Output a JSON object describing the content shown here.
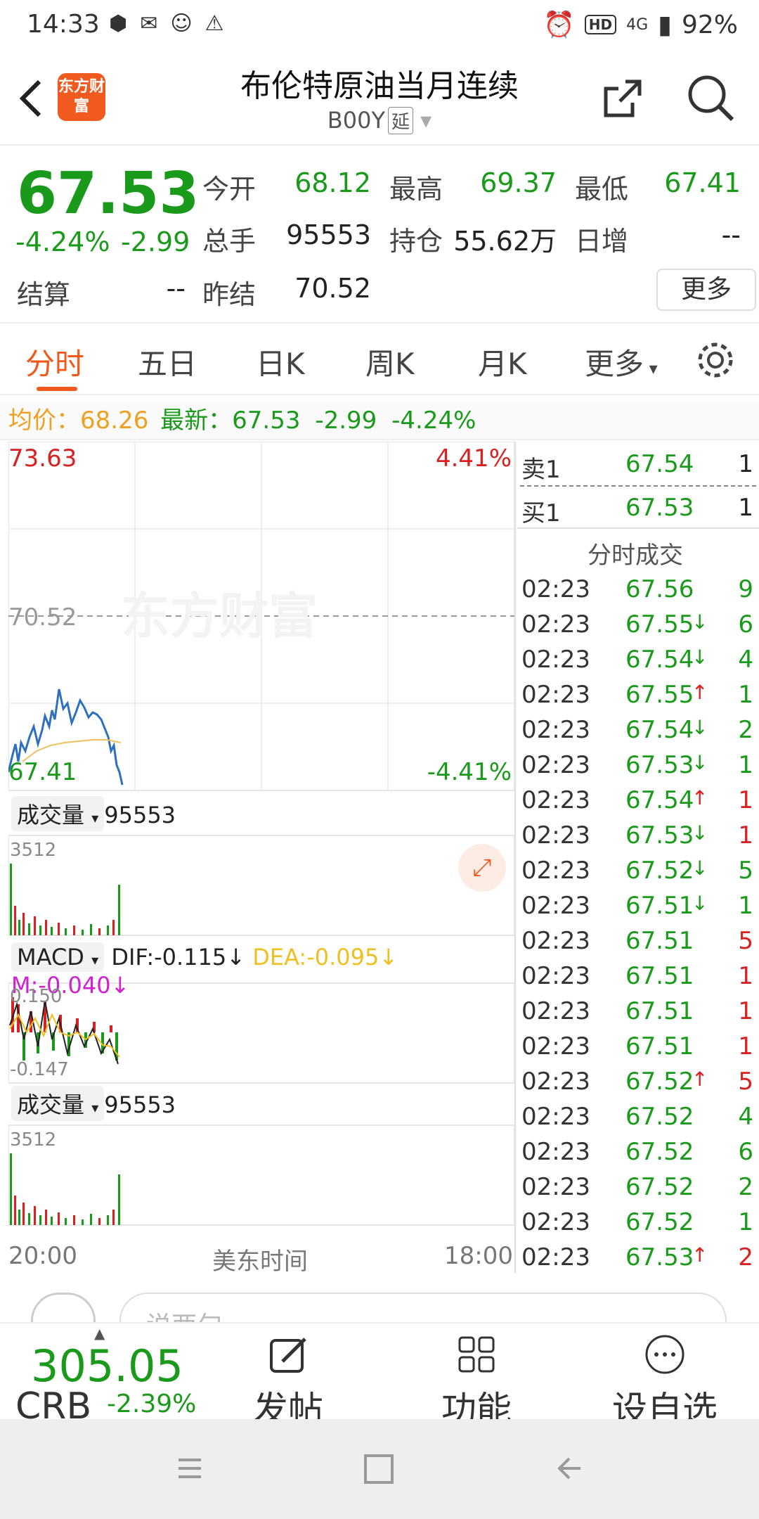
{
  "status_bar": {
    "time": "14:33",
    "battery": "92%",
    "network": "4G"
  },
  "header": {
    "title": "布伦特原油当月连续",
    "code": "B00Y",
    "delay_badge": "延",
    "logo_text": "东方财富"
  },
  "quote": {
    "price": "67.53",
    "change_pct": "-4.24%",
    "change": "-2.99",
    "open_label": "今开",
    "open": "68.12",
    "high_label": "最高",
    "high": "69.37",
    "low_label": "最低",
    "low": "67.41",
    "volume_label": "总手",
    "volume": "95553",
    "oi_label": "持仓",
    "oi": "55.62万",
    "daily_inc_label": "日增",
    "daily_inc": "--",
    "settle_label": "结算",
    "settle": "--",
    "prev_settle_label": "昨结",
    "prev_settle": "70.52",
    "more_button": "更多"
  },
  "tabs": [
    "分时",
    "五日",
    "日K",
    "周K",
    "月K",
    "更多"
  ],
  "avg_line": {
    "avg_label": "均价：",
    "avg": "68.26",
    "latest_label": "最新：",
    "latest": "67.53",
    "change": "-2.99",
    "pct": "-4.24%"
  },
  "chart": {
    "price_high": "73.63",
    "pct_high": "4.41%",
    "prev_close": "70.52",
    "price_low": "67.41",
    "pct_low": "-4.41%",
    "watermark": "东方财富",
    "vol_label": "成交量",
    "vol_value": "95553",
    "vol_max": "3512",
    "macd_label": "MACD",
    "dif": "DIF:-0.115",
    "dea": "DEA:-0.095",
    "m": "M:-0.040",
    "macd_high": "0.150",
    "macd_low": "-0.147",
    "vol2_label": "成交量",
    "vol2_value": "95553",
    "vol2_max": "3512",
    "time_start": "20:00",
    "time_mid": "美东时间",
    "time_end": "18:00"
  },
  "order_book": {
    "sell_label": "卖1",
    "sell_price": "67.54",
    "sell_vol": "1",
    "buy_label": "买1",
    "buy_price": "67.53",
    "buy_vol": "1",
    "trades_title": "分时成交"
  },
  "trades": [
    {
      "time": "02:23",
      "price": "67.56",
      "arrow": "",
      "vol": "9",
      "vcolor": "green"
    },
    {
      "time": "02:23",
      "price": "67.55",
      "arrow": "↓",
      "vol": "6",
      "vcolor": "green"
    },
    {
      "time": "02:23",
      "price": "67.54",
      "arrow": "↓",
      "vol": "4",
      "vcolor": "green"
    },
    {
      "time": "02:23",
      "price": "67.55",
      "arrow": "↑",
      "vol": "1",
      "vcolor": "green"
    },
    {
      "time": "02:23",
      "price": "67.54",
      "arrow": "↓",
      "vol": "2",
      "vcolor": "green"
    },
    {
      "time": "02:23",
      "price": "67.53",
      "arrow": "↓",
      "vol": "1",
      "vcolor": "green"
    },
    {
      "time": "02:23",
      "price": "67.54",
      "arrow": "↑",
      "vol": "1",
      "vcolor": "red"
    },
    {
      "time": "02:23",
      "price": "67.53",
      "arrow": "↓",
      "vol": "1",
      "vcolor": "red"
    },
    {
      "time": "02:23",
      "price": "67.52",
      "arrow": "↓",
      "vol": "5",
      "vcolor": "green"
    },
    {
      "time": "02:23",
      "price": "67.51",
      "arrow": "↓",
      "vol": "1",
      "vcolor": "green"
    },
    {
      "time": "02:23",
      "price": "67.51",
      "arrow": "",
      "vol": "5",
      "vcolor": "red"
    },
    {
      "time": "02:23",
      "price": "67.51",
      "arrow": "",
      "vol": "1",
      "vcolor": "red"
    },
    {
      "time": "02:23",
      "price": "67.51",
      "arrow": "",
      "vol": "1",
      "vcolor": "red"
    },
    {
      "time": "02:23",
      "price": "67.51",
      "arrow": "",
      "vol": "1",
      "vcolor": "red"
    },
    {
      "time": "02:23",
      "price": "67.52",
      "arrow": "↑",
      "vol": "5",
      "vcolor": "red"
    },
    {
      "time": "02:23",
      "price": "67.52",
      "arrow": "",
      "vol": "4",
      "vcolor": "green"
    },
    {
      "time": "02:23",
      "price": "67.52",
      "arrow": "",
      "vol": "6",
      "vcolor": "green"
    },
    {
      "time": "02:23",
      "price": "67.52",
      "arrow": "",
      "vol": "2",
      "vcolor": "green"
    },
    {
      "time": "02:23",
      "price": "67.52",
      "arrow": "",
      "vol": "1",
      "vcolor": "green"
    },
    {
      "time": "02:23",
      "price": "67.53",
      "arrow": "↑",
      "vol": "2",
      "vcolor": "red"
    }
  ],
  "comment_bar": {
    "placeholder": "说两句"
  },
  "bottom": {
    "crb_price": "305.05",
    "crb_name": "CRB",
    "crb_change": "-2.39%",
    "post": "发帖",
    "function": "功能",
    "watchlist": "设自选"
  },
  "colors": {
    "up": "#d92121",
    "down": "#1a9a1a",
    "accent": "#f05a1e",
    "avg": "#f0a020"
  }
}
